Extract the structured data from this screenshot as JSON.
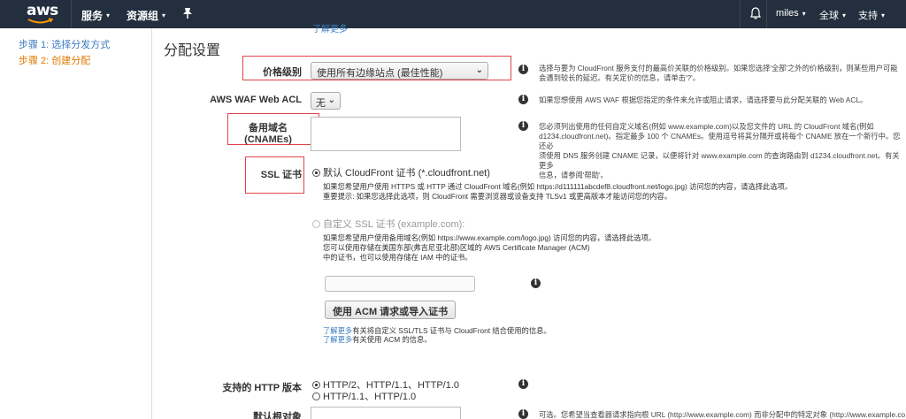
{
  "nav": {
    "logo_text": "aws",
    "services": "服务",
    "resource_groups": "资源组",
    "user": "miles",
    "region": "全球",
    "support": "支持"
  },
  "sidebar": {
    "steps": [
      {
        "label": "步骤 1: 选择分发方式"
      },
      {
        "label": "步骤 2: 创建分配"
      }
    ]
  },
  "main": {
    "top_link": "了解更多",
    "title": "分配设置",
    "price_class": {
      "label": "价格级别",
      "value": "使用所有边缘站点 (最佳性能)",
      "help": "选择与要为 CloudFront 服务支付的最高价关联的价格级别。如果您选择'全部'之外的价格级别，则某些用户可能会遇到较长的延迟。有关定价的信息，请单击'?'。"
    },
    "waf": {
      "label": "AWS WAF Web ACL",
      "value": "无",
      "help": "如果您想使用 AWS WAF 根据您指定的条件来允许或阻止请求，请选择要与此分配关联的 Web ACL。"
    },
    "cnames": {
      "label_line1": "备用域名",
      "label_line2": "(CNAMEs)",
      "value": "",
      "help_lines": [
        "您必须列出使用的任何自定义域名(例如 www.example.com)以及您文件的 URL 的 CloudFront 域名(例如",
        "d1234.cloudfront.net)。指定最多 100 个 CNAMEs。使用逗号将其分隔开或将每个 CNAME 放在一个新行中。您还必",
        "须使用 DNS 服务创建 CNAME 记录，以便将针对 www.example.com 的查询路由到 d1234.cloudfront.net。有关更多",
        "信息，请参阅'帮助'。"
      ]
    },
    "ssl": {
      "label": "SSL 证书",
      "default_option": "默认 CloudFront 证书 (*.cloudfront.net)",
      "default_desc": [
        "如果您希望用户使用 HTTPS 或 HTTP 通过 CloudFront 域名(例如 https://d111111abcdef8.cloudfront.net/logo.jpg) 访问您的内容，请选择此选项。",
        "重要提示: 如果您选择此选项，则 CloudFront 需要浏览器或设备支持 TLSv1 或更高版本才能访问您的内容。"
      ],
      "custom_option": "自定义 SSL 证书 (example.com):",
      "custom_desc": [
        "如果您希望用户使用备用域名(例如 https://www.example.com/logo.jpg) 访问您的内容，请选择此选项。",
        "您可以使用存储在美国东部(弗吉尼亚北部)区域的 AWS Certificate Manager (ACM)",
        "中的证书，也可以使用存储在 IAM 中的证书。"
      ],
      "cert_input": "",
      "acm_button": "使用 ACM 请求或导入证书",
      "learn_more": "了解更多",
      "link1_rest": "有关将自定义 SSL/TLS 证书与 CloudFront 结合使用的信息。",
      "link2_rest": "有关使用 ACM 的信息。"
    },
    "http": {
      "label": "支持的 HTTP 版本",
      "option1": "HTTP/2、HTTP/1.1、HTTP/1.0",
      "option2": "HTTP/1.1、HTTP/1.0"
    },
    "root_object": {
      "label": "默认根对象",
      "value": "",
      "help": "可选。您希望当查看器请求指向根 URL (http://www.example.com) 而非分配中的特定对象 (http://www.example.com"
    }
  }
}
